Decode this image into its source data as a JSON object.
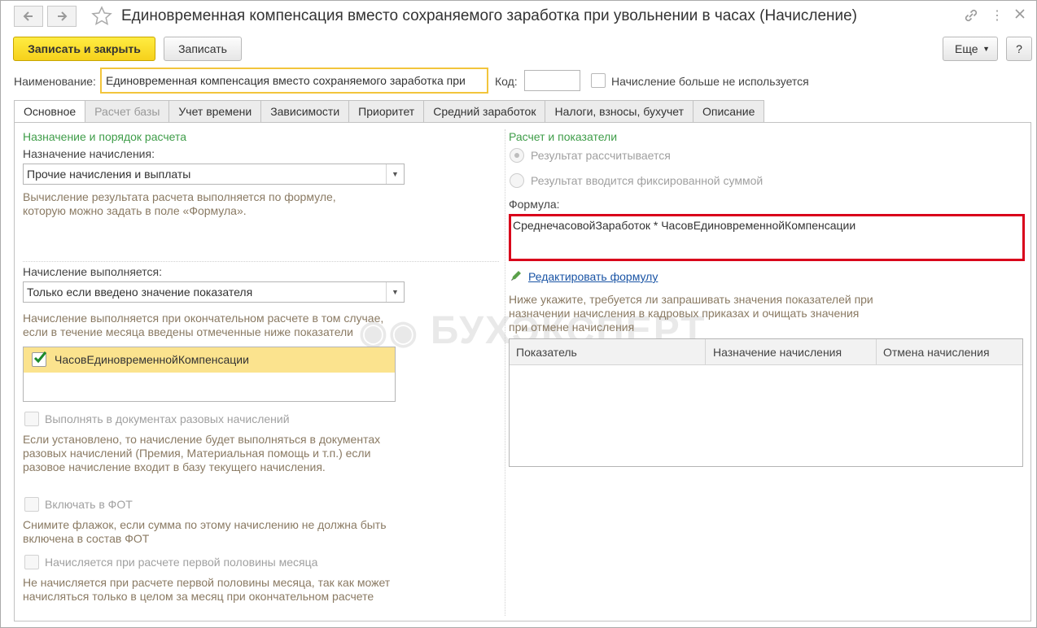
{
  "window": {
    "title": "Единовременная компенсация вместо сохраняемого заработка при увольнении в часах (Начисление)"
  },
  "toolbar": {
    "save_close": "Записать и закрыть",
    "save": "Записать",
    "more": "Еще",
    "help": "?"
  },
  "header": {
    "name_label": "Наименование:",
    "name_value": "Единовременная компенсация вместо сохраняемого заработка при",
    "code_label": "Код:",
    "code_value": "",
    "unused_label": "Начисление больше не используется"
  },
  "tabs": [
    {
      "label": "Основное"
    },
    {
      "label": "Расчет базы"
    },
    {
      "label": "Учет времени"
    },
    {
      "label": "Зависимости"
    },
    {
      "label": "Приоритет"
    },
    {
      "label": "Средний заработок"
    },
    {
      "label": "Налоги, взносы, бухучет"
    },
    {
      "label": "Описание"
    }
  ],
  "left": {
    "section_title": "Назначение и порядок расчета",
    "purpose_label": "Назначение начисления:",
    "purpose_value": "Прочие начисления и выплаты",
    "purpose_hint": "Вычисление результата расчета выполняется по формуле, которую можно задать в поле «Формула».",
    "exec_label": "Начисление выполняется:",
    "exec_value": "Только если введено значение показателя",
    "exec_hint": "Начисление выполняется при окончательном расчете в том случае, если в течение месяца введены отмеченные ниже показатели",
    "indicator_item": "ЧасовЕдиновременнойКомпенсации",
    "one_time_label": "Выполнять в документах разовых начислений",
    "one_time_hint": "Если установлено, то начисление будет выполняться в документах разовых начислений (Премия, Материальная помощь и т.п.) если разовое начисление входит в базу текущего начисления.",
    "fot_label": "Включать в ФОТ",
    "fot_hint": "Снимите флажок, если сумма по этому начислению не должна быть включена в состав ФОТ",
    "half_label": "Начисляется при расчете первой половины месяца",
    "half_hint": "Не начисляется при расчете первой половины месяца, так как может начисляться только в целом за месяц при окончательном расчете"
  },
  "right": {
    "section_title": "Расчет и показатели",
    "radio_calc": "Результат рассчитывается",
    "radio_fixed": "Результат вводится фиксированной суммой",
    "formula_label": "Формула:",
    "formula_value": "СреднечасовойЗаработок * ЧасовЕдиновременнойКомпенсации",
    "edit_formula": "Редактировать формулу",
    "indicators_hint": "Ниже укажите, требуется ли запрашивать значения показателей при назначении начисления в кадровых приказах и очищать значения при отмене начисления",
    "table_headers": [
      "Показатель",
      "Назначение начисления",
      "Отмена начисления"
    ]
  },
  "watermark": "БУХЭКСПЕРТ",
  "colors": {
    "accent_yellow": "#f6d11b",
    "section_green": "#3f9d49",
    "highlight_red": "#d9001b",
    "link_blue": "#1a54a5"
  }
}
